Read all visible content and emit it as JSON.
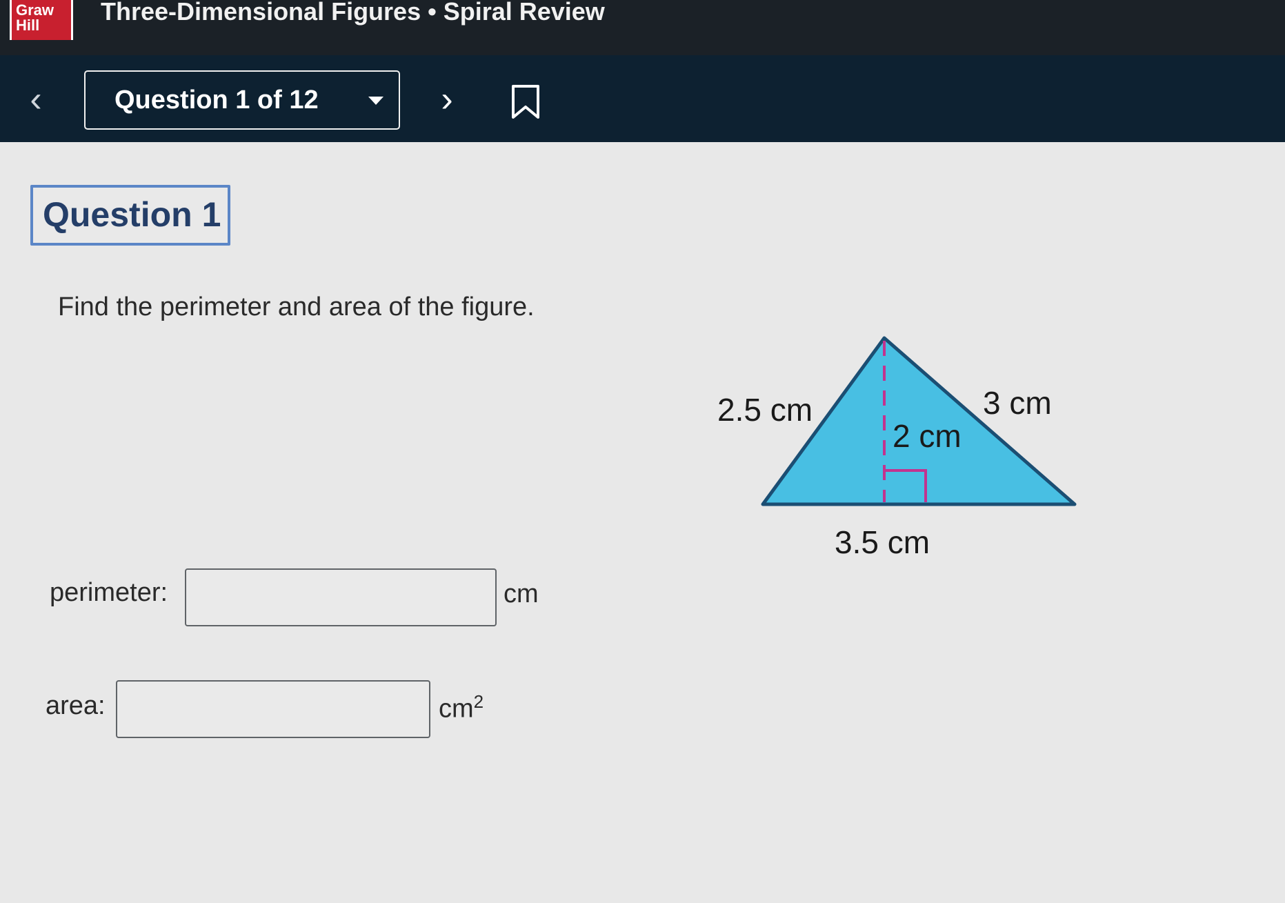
{
  "header": {
    "logo_line1": "Graw",
    "logo_line2": "Hill",
    "title": "Three-Dimensional Figures • Spiral Review"
  },
  "nav": {
    "question_selector": "Question 1 of 12",
    "prev_icon": "chevron-left-icon",
    "next_icon": "chevron-right-icon",
    "bookmark_icon": "bookmark-icon"
  },
  "question": {
    "heading": "Question 1",
    "prompt": "Find the perimeter and area of the figure."
  },
  "figure": {
    "left_side": "2.5 cm",
    "right_side": "3 cm",
    "height": "2 cm",
    "base": "3.5 cm",
    "fill_color": "#48bfe3",
    "height_line_color": "#c2338f"
  },
  "answers": {
    "perimeter_label": "perimeter:",
    "perimeter_value": "",
    "perimeter_unit": "cm",
    "area_label": "area:",
    "area_value": "",
    "area_unit": "cm",
    "area_unit_exponent": "2"
  }
}
